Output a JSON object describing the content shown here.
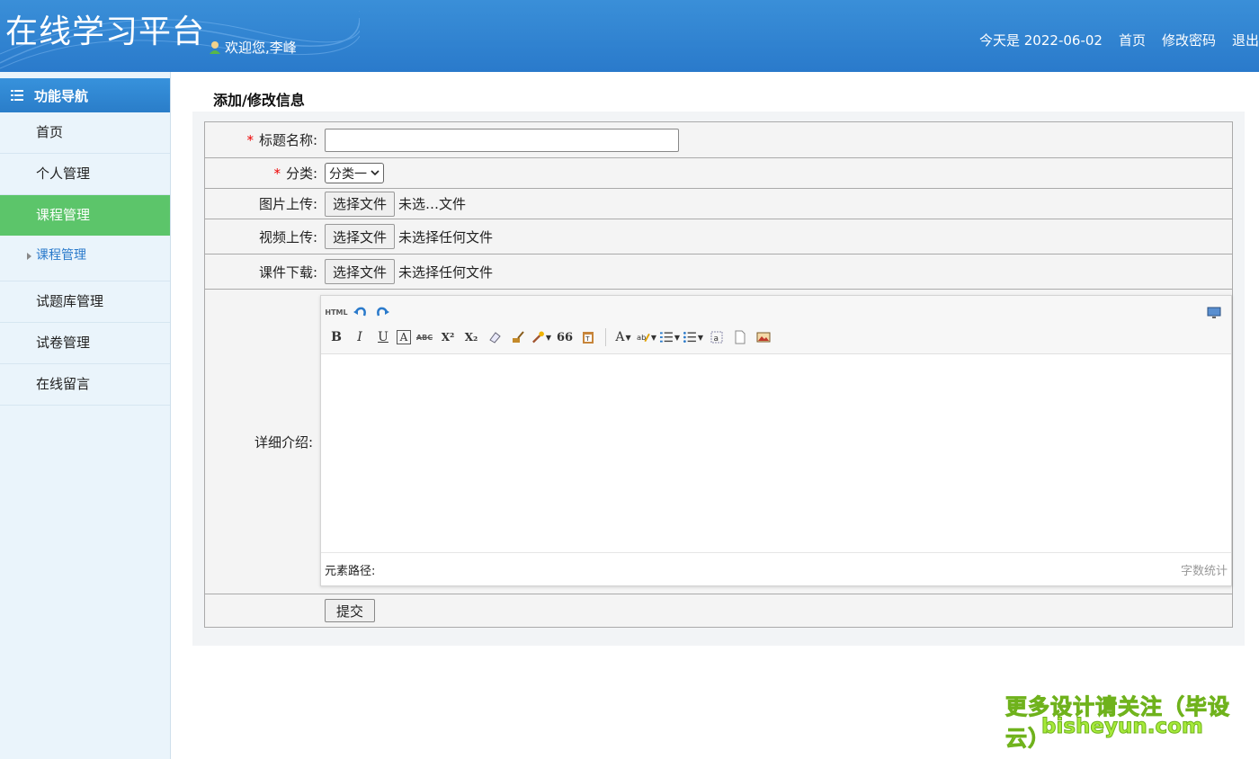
{
  "header": {
    "title": "在线学习平台",
    "welcome": "欢迎您,李峰",
    "date_text": "今天是 2022-06-02",
    "links": [
      "首页",
      "修改密码",
      "退出"
    ]
  },
  "sidebar": {
    "heading": "功能导航",
    "items": [
      {
        "label": "首页"
      },
      {
        "label": "个人管理"
      },
      {
        "label": "课程管理"
      },
      {
        "label": "课程管理"
      },
      {
        "label": "试题库管理"
      },
      {
        "label": "试卷管理"
      },
      {
        "label": "在线留言"
      }
    ]
  },
  "main": {
    "page_title": "添加/修改信息",
    "form": {
      "title_label": "标题名称:",
      "title_value": "",
      "category_label": "分类:",
      "category_value": "分类一",
      "image_label": "图片上传:",
      "image_button": "选择文件",
      "image_status": "未选…文件",
      "video_label": "视频上传:",
      "video_button": "选择文件",
      "video_status": "未选择任何文件",
      "courseware_label": "课件下载:",
      "courseware_button": "选择文件",
      "courseware_status": "未选择任何文件",
      "detail_label": "详细介绍:",
      "submit_label": "提交"
    },
    "editor": {
      "html_label": "HTML",
      "bold": "B",
      "italic": "I",
      "underline": "U",
      "fontcolor": "A",
      "strike": "ABC",
      "sup": "X²",
      "sub": "X₂",
      "quote": "66",
      "path_label": "元素路径:",
      "word_count": "字数统计"
    }
  },
  "watermark": {
    "line1": "更多设计请关注（毕设云）",
    "line2": "bisheyun.com"
  },
  "colors": {
    "header": "#2a7acb",
    "sidebar_bg": "#eaf4fb",
    "active_nav": "#5cc56a",
    "required": "#e00000"
  }
}
